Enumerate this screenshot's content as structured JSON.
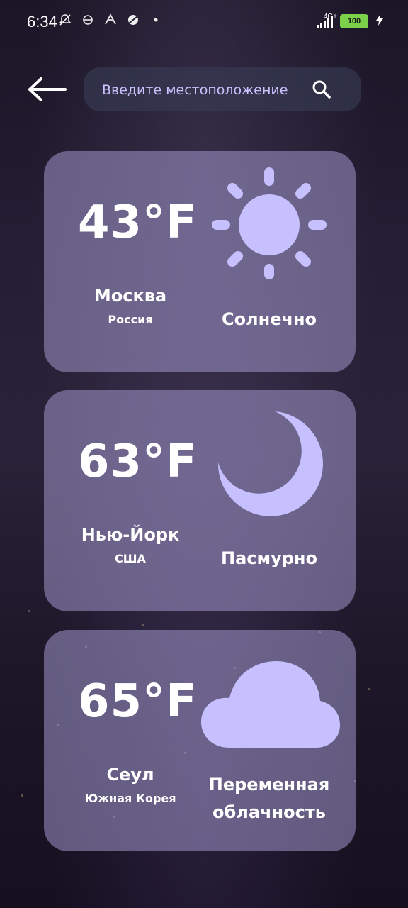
{
  "status_bar": {
    "time": "6:34",
    "network": "4G+",
    "battery": "100"
  },
  "search": {
    "placeholder": "Введите местоположение",
    "icon": "search-icon"
  },
  "colors": {
    "card": "#a69ed2",
    "icon": "#c6c0ff",
    "placeholder": "#c9c3ff"
  },
  "cards": [
    {
      "temp": "43°F",
      "city": "Москва",
      "country": "Россия",
      "condition": "Солнечно",
      "icon": "sun-icon"
    },
    {
      "temp": "63°F",
      "city": "Нью-Йорк",
      "country": "США",
      "condition": "Пасмурно",
      "icon": "moon-icon"
    },
    {
      "temp": "65°F",
      "city": "Сеул",
      "country": "Южная Корея",
      "condition": "Переменная облачность",
      "icon": "cloud-icon"
    }
  ]
}
